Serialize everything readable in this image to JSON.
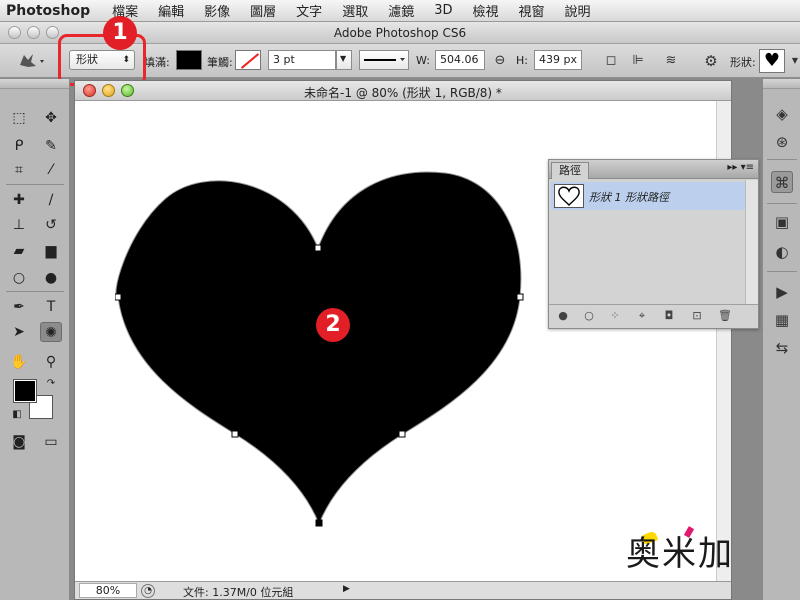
{
  "menubar": {
    "app": "Photoshop",
    "items": [
      "檔案",
      "編輯",
      "影像",
      "圖層",
      "文字",
      "選取",
      "濾鏡",
      "3D",
      "檢視",
      "視窗",
      "說明"
    ]
  },
  "window": {
    "title": "Adobe Photoshop CS6"
  },
  "options_bar": {
    "mode_value": "形狀",
    "fill_label": "填滿:",
    "stroke_label": "筆觸:",
    "stroke_width": "3 pt",
    "width_label": "W:",
    "width_value": "504.06",
    "height_label": "H:",
    "height_value": "439 px",
    "shape_label": "形狀:",
    "fill_color": "#000000",
    "stroke_color": "none"
  },
  "document": {
    "title": "未命名-1 @ 80% (形狀 1, RGB/8) *",
    "zoom": "80%",
    "status": "文件: 1.37M/0 位元組",
    "shape_color": "#000000"
  },
  "callouts": {
    "one": "1",
    "two": "2",
    "color": "#e21f26"
  },
  "paths_panel": {
    "tab": "路徑",
    "row_label": "形狀 1 形狀路徑",
    "row_highlight": "#bcd0ee"
  },
  "watermark": {
    "text": "奥米加",
    "accent": "#2a8fd6"
  },
  "icons": {
    "toolbox": [
      "marquee-icon",
      "move-icon",
      "lasso-icon",
      "quick-select-icon",
      "crop-icon",
      "eyedropper-icon",
      "healing-icon",
      "brush-icon",
      "stamp-icon",
      "history-brush-icon",
      "eraser-icon",
      "gradient-icon",
      "blur-icon",
      "dodge-icon",
      "pen-icon",
      "type-icon",
      "path-select-icon",
      "custom-shape-icon",
      "hand-icon",
      "zoom-icon"
    ],
    "dock": [
      "layers-icon",
      "channels-icon",
      "paths-icon",
      "3d-icon",
      "adjustments-icon",
      "actions-icon",
      "swatches-icon",
      "history-icon"
    ]
  }
}
